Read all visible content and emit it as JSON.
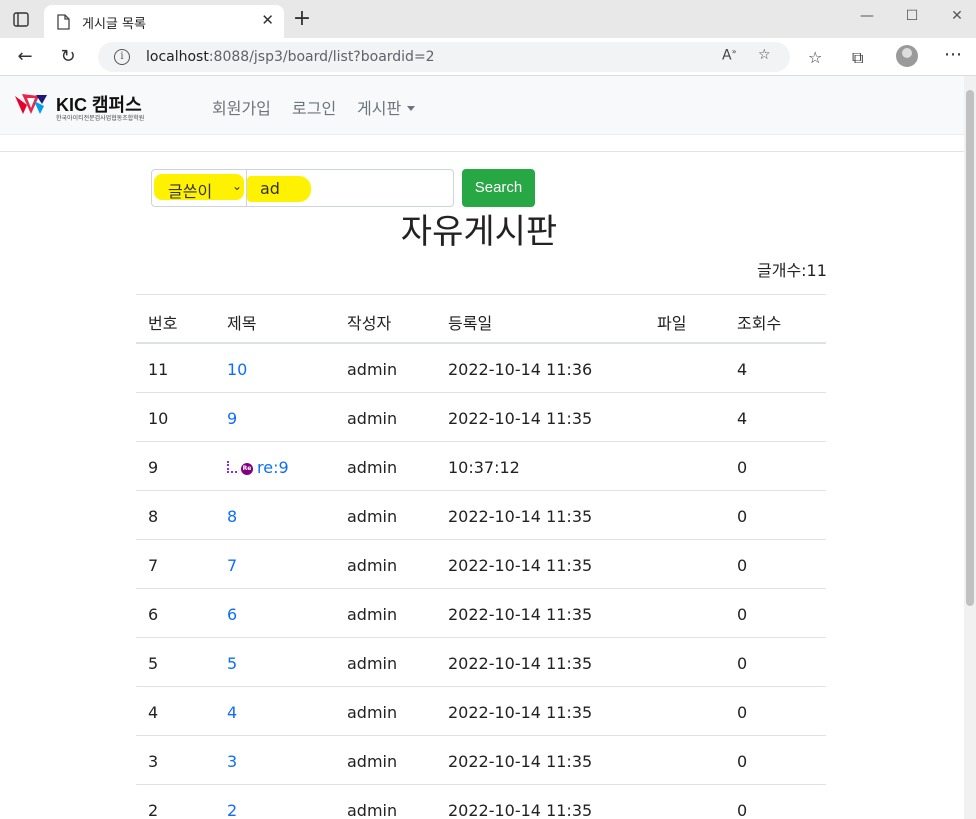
{
  "browser": {
    "tab_title": "게시글 목록",
    "url_host": "localhost",
    "url_rest": ":8088/jsp3/board/list?boardid=2"
  },
  "navbar": {
    "brand": "KIC 캠퍼스",
    "brand_sub": "한국아이티전문검사업협동조합학원",
    "links": [
      "회원가입",
      "로그인",
      "게시판"
    ]
  },
  "search": {
    "select_value": "글쓴이",
    "input_value": "ad",
    "button_label": "Search",
    "highlight_color": "#fff200"
  },
  "board": {
    "title": "자유게시판",
    "count_label": "글개수:11"
  },
  "table": {
    "headers": [
      "번호",
      "제목",
      "작성자",
      "등록일",
      "파일",
      "조회수"
    ],
    "rows": [
      {
        "num": "11",
        "title": "10",
        "author": "admin",
        "date": "2022-10-14 11:36",
        "file": "",
        "views": "4",
        "reply": false
      },
      {
        "num": "10",
        "title": "9",
        "author": "admin",
        "date": "2022-10-14 11:35",
        "file": "",
        "views": "4",
        "reply": false
      },
      {
        "num": "9",
        "title": "re:9",
        "author": "admin",
        "date": "10:37:12",
        "file": "",
        "views": "0",
        "reply": true
      },
      {
        "num": "8",
        "title": "8",
        "author": "admin",
        "date": "2022-10-14 11:35",
        "file": "",
        "views": "0",
        "reply": false
      },
      {
        "num": "7",
        "title": "7",
        "author": "admin",
        "date": "2022-10-14 11:35",
        "file": "",
        "views": "0",
        "reply": false
      },
      {
        "num": "6",
        "title": "6",
        "author": "admin",
        "date": "2022-10-14 11:35",
        "file": "",
        "views": "0",
        "reply": false
      },
      {
        "num": "5",
        "title": "5",
        "author": "admin",
        "date": "2022-10-14 11:35",
        "file": "",
        "views": "0",
        "reply": false
      },
      {
        "num": "4",
        "title": "4",
        "author": "admin",
        "date": "2022-10-14 11:35",
        "file": "",
        "views": "0",
        "reply": false
      },
      {
        "num": "3",
        "title": "3",
        "author": "admin",
        "date": "2022-10-14 11:35",
        "file": "",
        "views": "0",
        "reply": false
      },
      {
        "num": "2",
        "title": "2",
        "author": "admin",
        "date": "2022-10-14 11:35",
        "file": "",
        "views": "0",
        "reply": false
      }
    ]
  },
  "icons": {
    "reply": "reply-icon",
    "reply_color": "#800080"
  }
}
